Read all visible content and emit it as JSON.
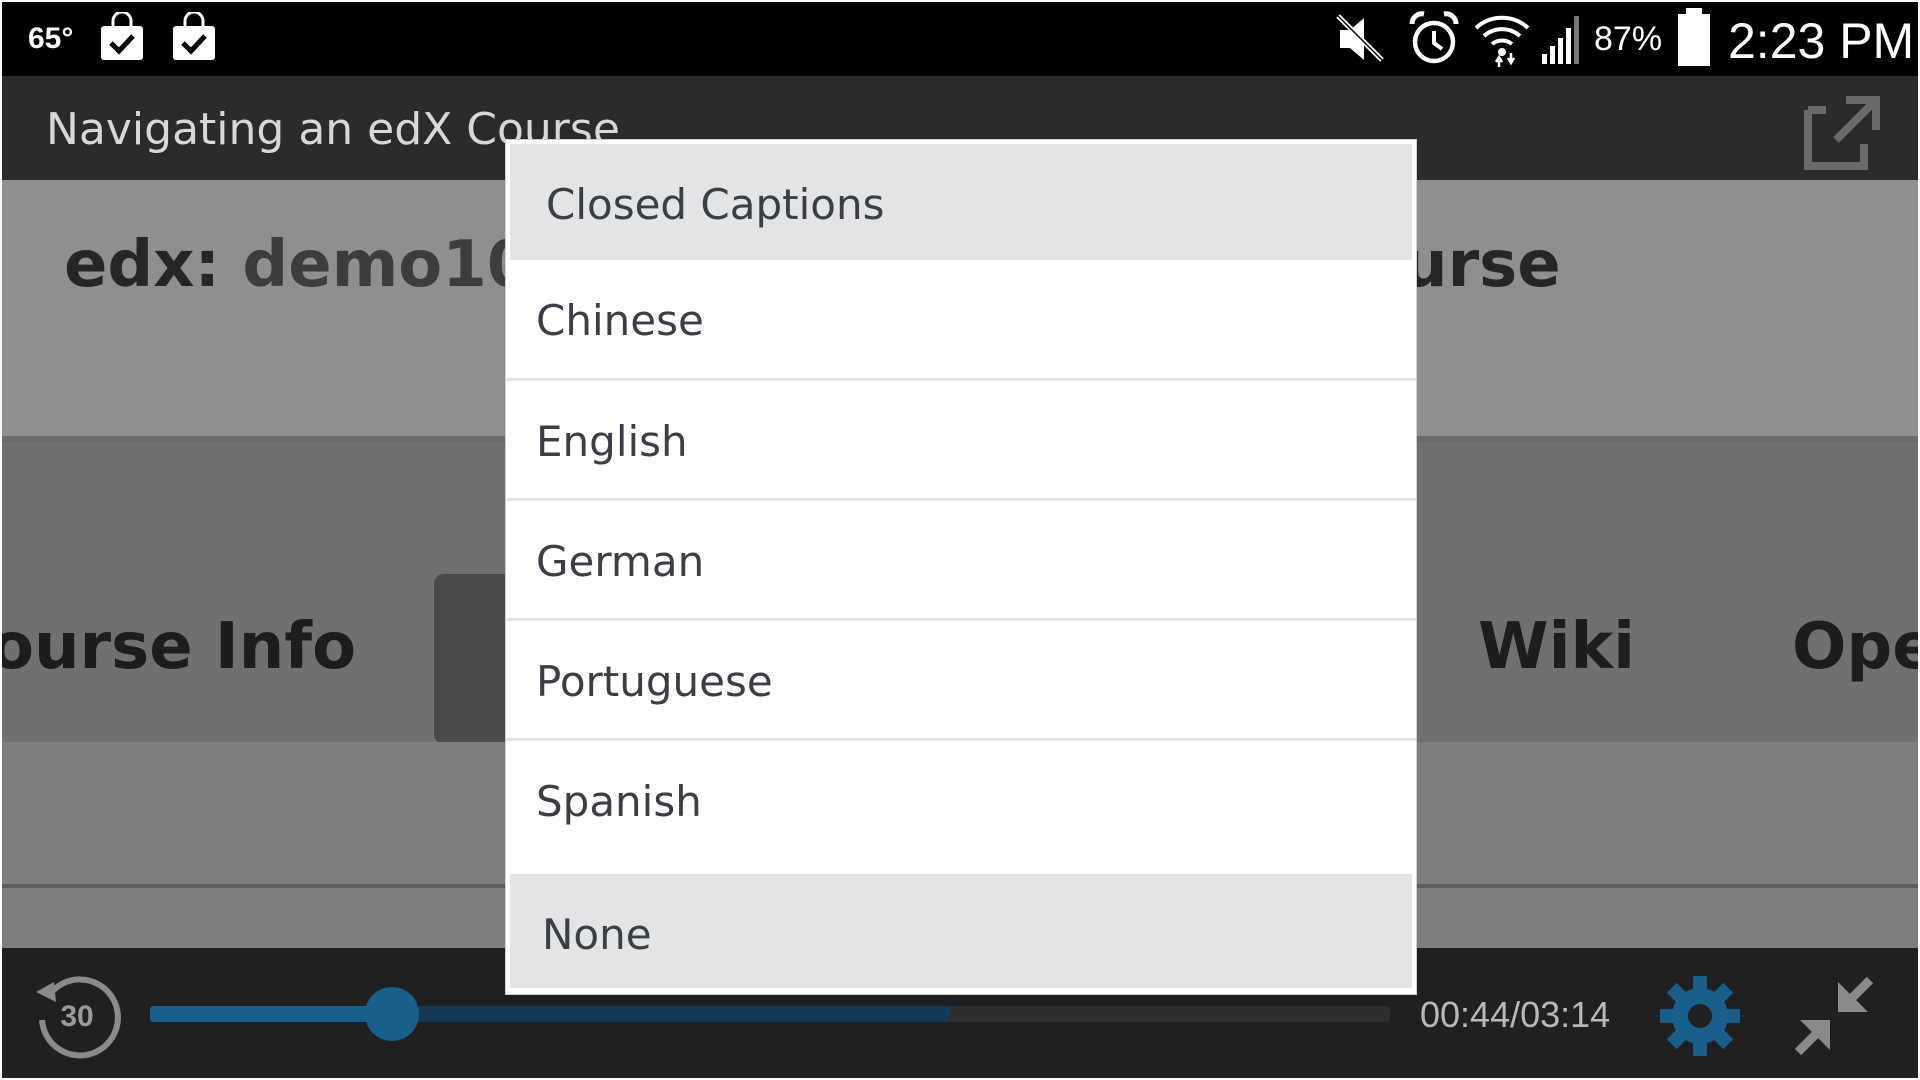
{
  "status_bar": {
    "temperature": "65°",
    "battery_percent": "87%",
    "time": "2:23 PM",
    "icons": [
      "shopping-bag-check-icon",
      "shopping-bag-check-icon",
      "mute-icon",
      "alarm-icon",
      "wifi-icon",
      "signal-icon",
      "battery-icon"
    ]
  },
  "video": {
    "title": "Navigating an edX Course",
    "header_left": "edx:",
    "header_mid": "demo10",
    "header_right": "urse",
    "nav_items": [
      "ourse Info",
      "Wiki",
      "Ope"
    ]
  },
  "dialog": {
    "title": "Closed Captions",
    "options": [
      "Chinese",
      "English",
      "German",
      "Portuguese",
      "Spanish"
    ],
    "none_label": "None"
  },
  "player": {
    "replay_seconds": "30",
    "time_readout": "00:44/03:14",
    "played_fraction": 0.195,
    "buffered_fraction": 0.645,
    "accent": "#1a5e8c"
  }
}
